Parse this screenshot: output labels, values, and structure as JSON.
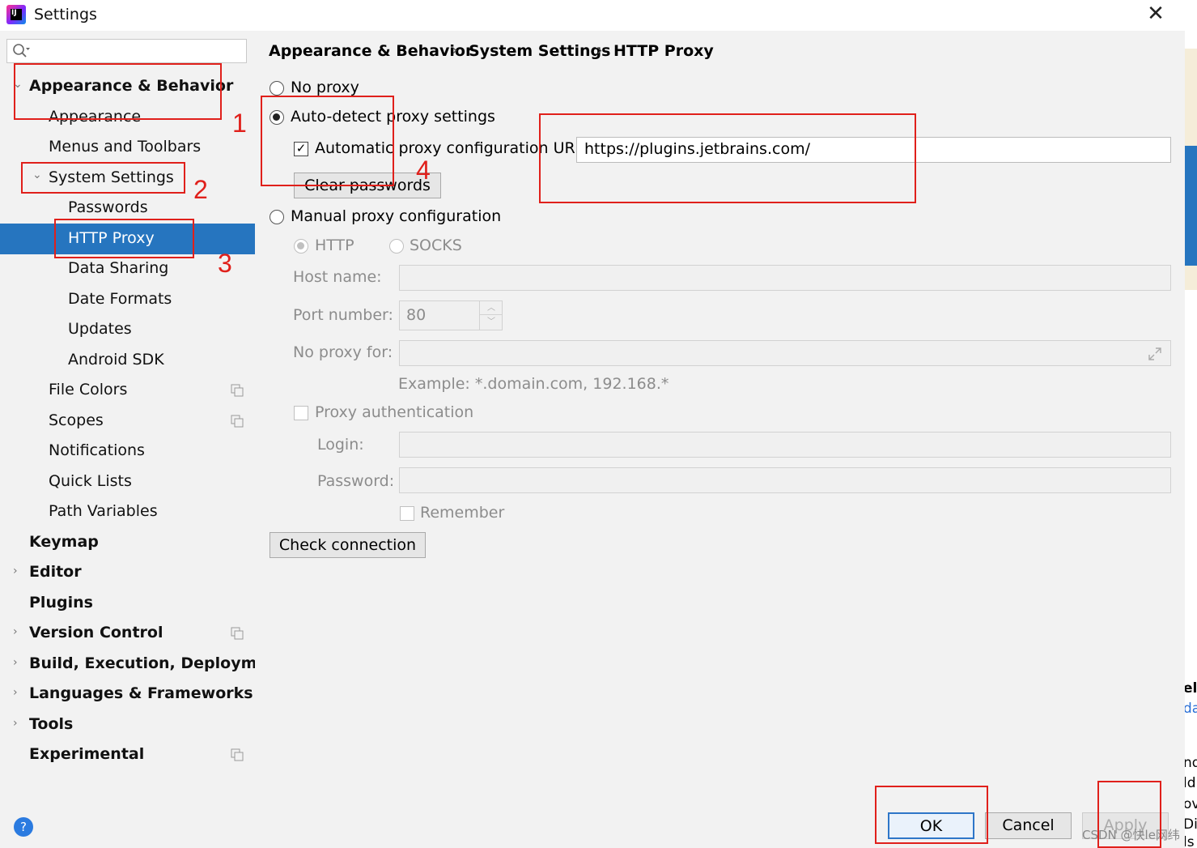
{
  "window": {
    "title": "Settings",
    "close_glyph": "✕"
  },
  "breadcrumb": {
    "part1": "Appearance & Behavior",
    "part2": "System Settings",
    "part3": "HTTP Proxy",
    "separator": "›"
  },
  "sidebar": {
    "search_placeholder": "",
    "items": [
      {
        "label": "Appearance & Behavior"
      },
      {
        "label": "Appearance"
      },
      {
        "label": "Menus and Toolbars"
      },
      {
        "label": "System Settings"
      },
      {
        "label": "Passwords"
      },
      {
        "label": "HTTP Proxy"
      },
      {
        "label": "Data Sharing"
      },
      {
        "label": "Date Formats"
      },
      {
        "label": "Updates"
      },
      {
        "label": "Android SDK"
      },
      {
        "label": "File Colors"
      },
      {
        "label": "Scopes"
      },
      {
        "label": "Notifications"
      },
      {
        "label": "Quick Lists"
      },
      {
        "label": "Path Variables"
      },
      {
        "label": "Keymap"
      },
      {
        "label": "Editor"
      },
      {
        "label": "Plugins"
      },
      {
        "label": "Version Control"
      },
      {
        "label": "Build, Execution, Deployment"
      },
      {
        "label": "Languages & Frameworks"
      },
      {
        "label": "Tools"
      },
      {
        "label": "Experimental"
      }
    ]
  },
  "proxy": {
    "no_proxy": "No proxy",
    "auto_detect": "Auto-detect proxy settings",
    "auto_url_label": "Automatic proxy configuration URL:",
    "auto_url_value": "https://plugins.jetbrains.com/",
    "clear_passwords": "Clear passwords",
    "manual": "Manual proxy configuration",
    "http": "HTTP",
    "socks": "SOCKS",
    "host_label": "Host name:",
    "port_label": "Port number:",
    "port_value": "80",
    "no_proxy_for_label": "No proxy for:",
    "example": "Example: *.domain.com, 192.168.*",
    "proxy_auth": "Proxy authentication",
    "login_label": "Login:",
    "password_label": "Password:",
    "remember": "Remember",
    "check_connection": "Check connection"
  },
  "annotations": {
    "n1": "1",
    "n2": "2",
    "n3": "3",
    "n4": "4"
  },
  "footer": {
    "help": "?",
    "ok": "OK",
    "cancel": "Cancel",
    "apply": "Apply",
    "watermark": "CSDN @快le网纬"
  },
  "background_window_fragments": {
    "a": "ell",
    "b": "da",
    "c": "nd",
    "d": "ld",
    "e": "ov",
    "f": "Di",
    "g": "ls"
  },
  "colors": {
    "selection": "#2675bf",
    "annotation_red": "#e0201b",
    "background": "#f2f2f2"
  }
}
